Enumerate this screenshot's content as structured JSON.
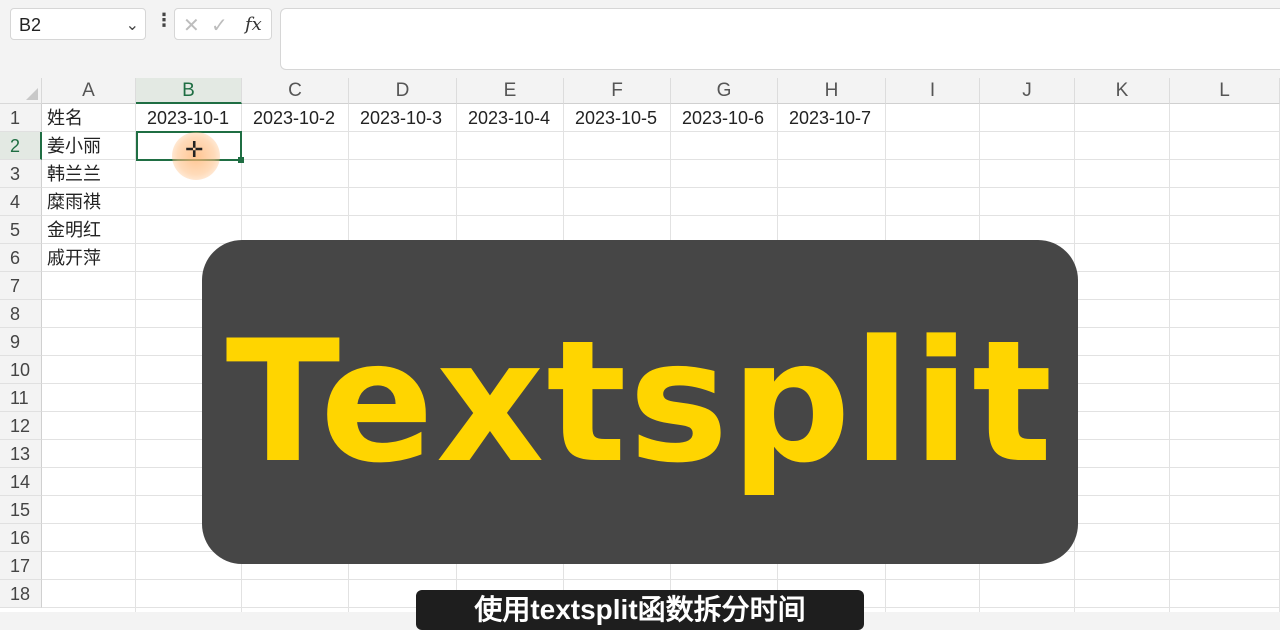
{
  "formula_bar": {
    "name_box": "B2",
    "chevron_icon": "chevron-down-icon",
    "more_icon": "vertical-ellipsis-icon",
    "cancel_glyph": "✕",
    "enter_glyph": "✓",
    "fx_label": "fx",
    "formula": ""
  },
  "sheet": {
    "columns": [
      "A",
      "B",
      "C",
      "D",
      "E",
      "F",
      "G",
      "H",
      "I",
      "J",
      "K",
      "L"
    ],
    "rows": [
      "1",
      "2",
      "3",
      "4",
      "5",
      "6",
      "7",
      "8",
      "9",
      "10",
      "11",
      "12",
      "13",
      "14",
      "15",
      "16",
      "17",
      "18"
    ],
    "active_column": "B",
    "active_row": "2",
    "cells": {
      "A1": "姓名",
      "B1": "2023-10-1",
      "C1": "2023-10-2",
      "D1": "2023-10-3",
      "E1": "2023-10-4",
      "F1": "2023-10-5",
      "G1": "2023-10-6",
      "H1": "2023-10-7",
      "A2": "姜小丽",
      "A3": "韩兰兰",
      "A4": "糜雨祺",
      "A5": "金明红",
      "A6": "戚开萍"
    }
  },
  "overlay": {
    "title": "Textsplit",
    "title_color": "#ffd500",
    "subtitle": "使用textsplit函数拆分时间"
  },
  "colors": {
    "accent": "#1f6e43",
    "banner_bg": "#464646"
  }
}
